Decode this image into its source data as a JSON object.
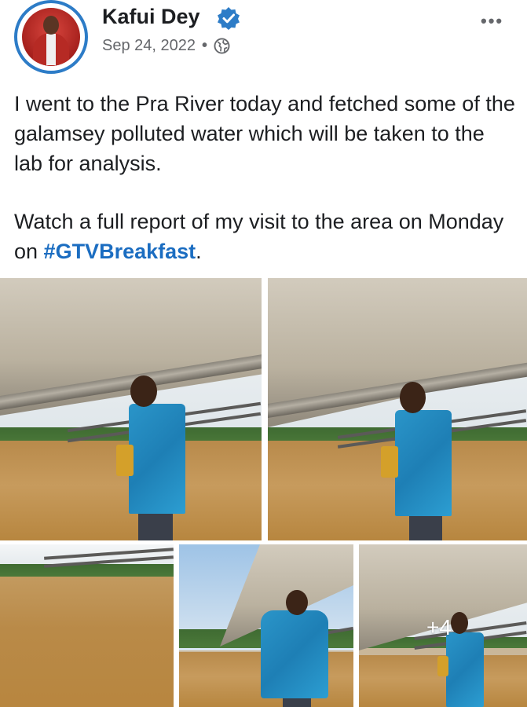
{
  "post": {
    "author": "Kafui Dey",
    "date": "Sep 24, 2022",
    "separator": "•",
    "more_label": "•••",
    "text_line1": "I went to the Pra River today and fetched some of the galamsey polluted water which will be taken to the lab for analysis.",
    "text_line2_prefix": "Watch a full report of my visit to the area on Monday on ",
    "hashtag": "#GTVBreakfast",
    "text_line2_suffix": "."
  },
  "gallery": {
    "more_count_label": "+4"
  },
  "icons": {
    "verified": "verified-badge-icon",
    "privacy": "globe-icon",
    "more": "more-options-icon"
  },
  "colors": {
    "verified_blue": "#2d7cc7",
    "hashtag_blue": "#1b6dc1",
    "meta_gray": "#65676b"
  }
}
